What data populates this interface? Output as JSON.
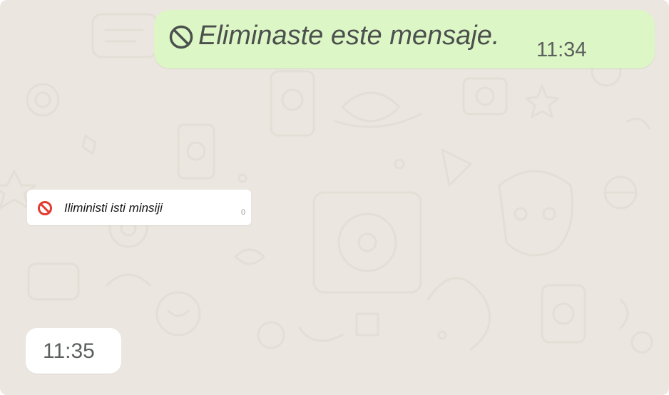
{
  "colors": {
    "chat_background": "#ebe6df",
    "outgoing_bubble": "#dcf7c5",
    "incoming_bubble": "#ffffff",
    "deleted_icon_red": "#e23b2e"
  },
  "outgoing_message": {
    "icon": "prohibited-icon",
    "text": "Eliminaste este mensaje.",
    "time": "11:34"
  },
  "incoming_message": {
    "icon": "prohibited-red-icon",
    "text": "Iliministi isti minsiji",
    "time": "0"
  },
  "standalone_time": {
    "time": "11:35"
  }
}
